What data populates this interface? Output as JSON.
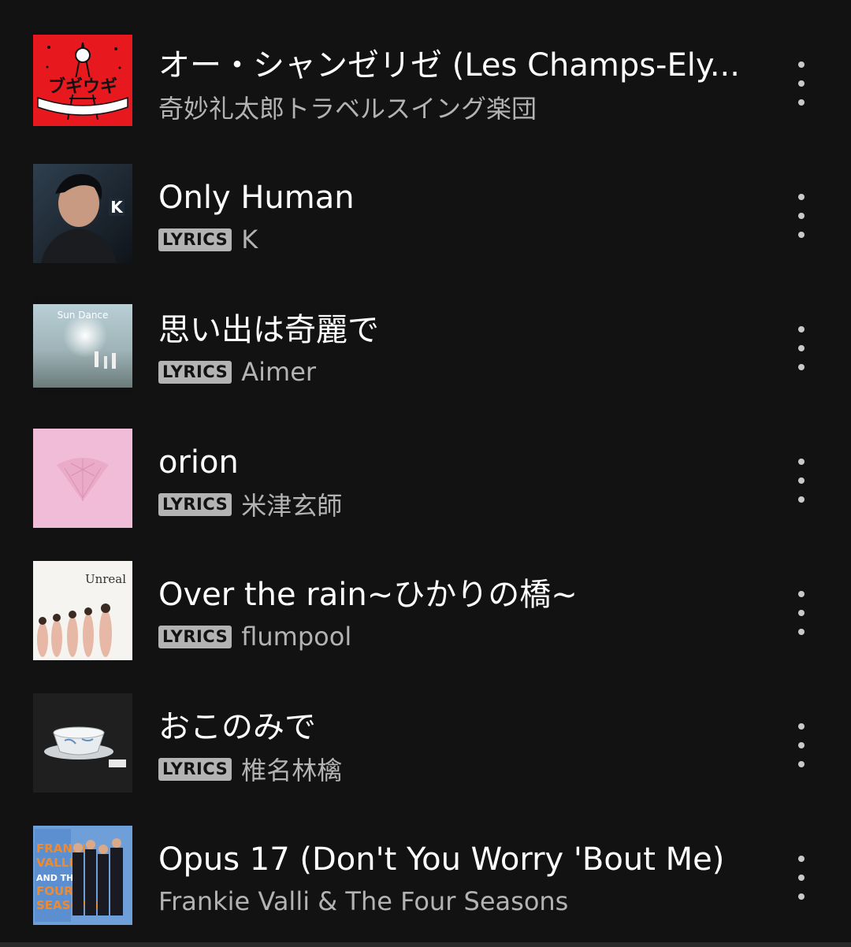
{
  "tracks": [
    {
      "title": "オー・シャンゼリゼ (Les Champs-Ely...",
      "artist": "奇妙礼太郎トラベルスイング楽団",
      "has_lyrics": false,
      "cover_text": "ブギウギ",
      "cover_color": "#e8191e"
    },
    {
      "title": "Only Human",
      "artist": "K",
      "has_lyrics": true,
      "lyrics_label": "LYRICS",
      "cover_text": "K",
      "cover_color": "#1e2a36"
    },
    {
      "title": "思い出は奇麗で",
      "artist": "Aimer",
      "has_lyrics": true,
      "lyrics_label": "LYRICS",
      "cover_text": "Sun Dance",
      "cover_color": "#8aa4b0"
    },
    {
      "title": "orion",
      "artist": "米津玄師",
      "has_lyrics": true,
      "lyrics_label": "LYRICS",
      "cover_color": "#f1bcd8"
    },
    {
      "title": "Over the rain~ひかりの橋~",
      "artist": "flumpool",
      "has_lyrics": true,
      "lyrics_label": "LYRICS",
      "cover_text": "Unreal",
      "cover_color": "#f6f4f1"
    },
    {
      "title": "おこのみで",
      "artist": "椎名林檎",
      "has_lyrics": true,
      "lyrics_label": "LYRICS",
      "cover_color": "#1f1f1f"
    },
    {
      "title": "Opus 17 (Don't You Worry 'Bout Me)",
      "artist": "Frankie Valli & The Four Seasons",
      "has_lyrics": false,
      "cover_text": "FRANKIE VALLI AND THE FOUR SEASONS",
      "cover_color": "#6f9fd8"
    }
  ],
  "colors": {
    "background": "#121212",
    "title": "#ffffff",
    "subtitle": "#b3b3b3",
    "badge": "#b3b3b3"
  },
  "icons": {
    "more": "more-vertical-icon"
  }
}
